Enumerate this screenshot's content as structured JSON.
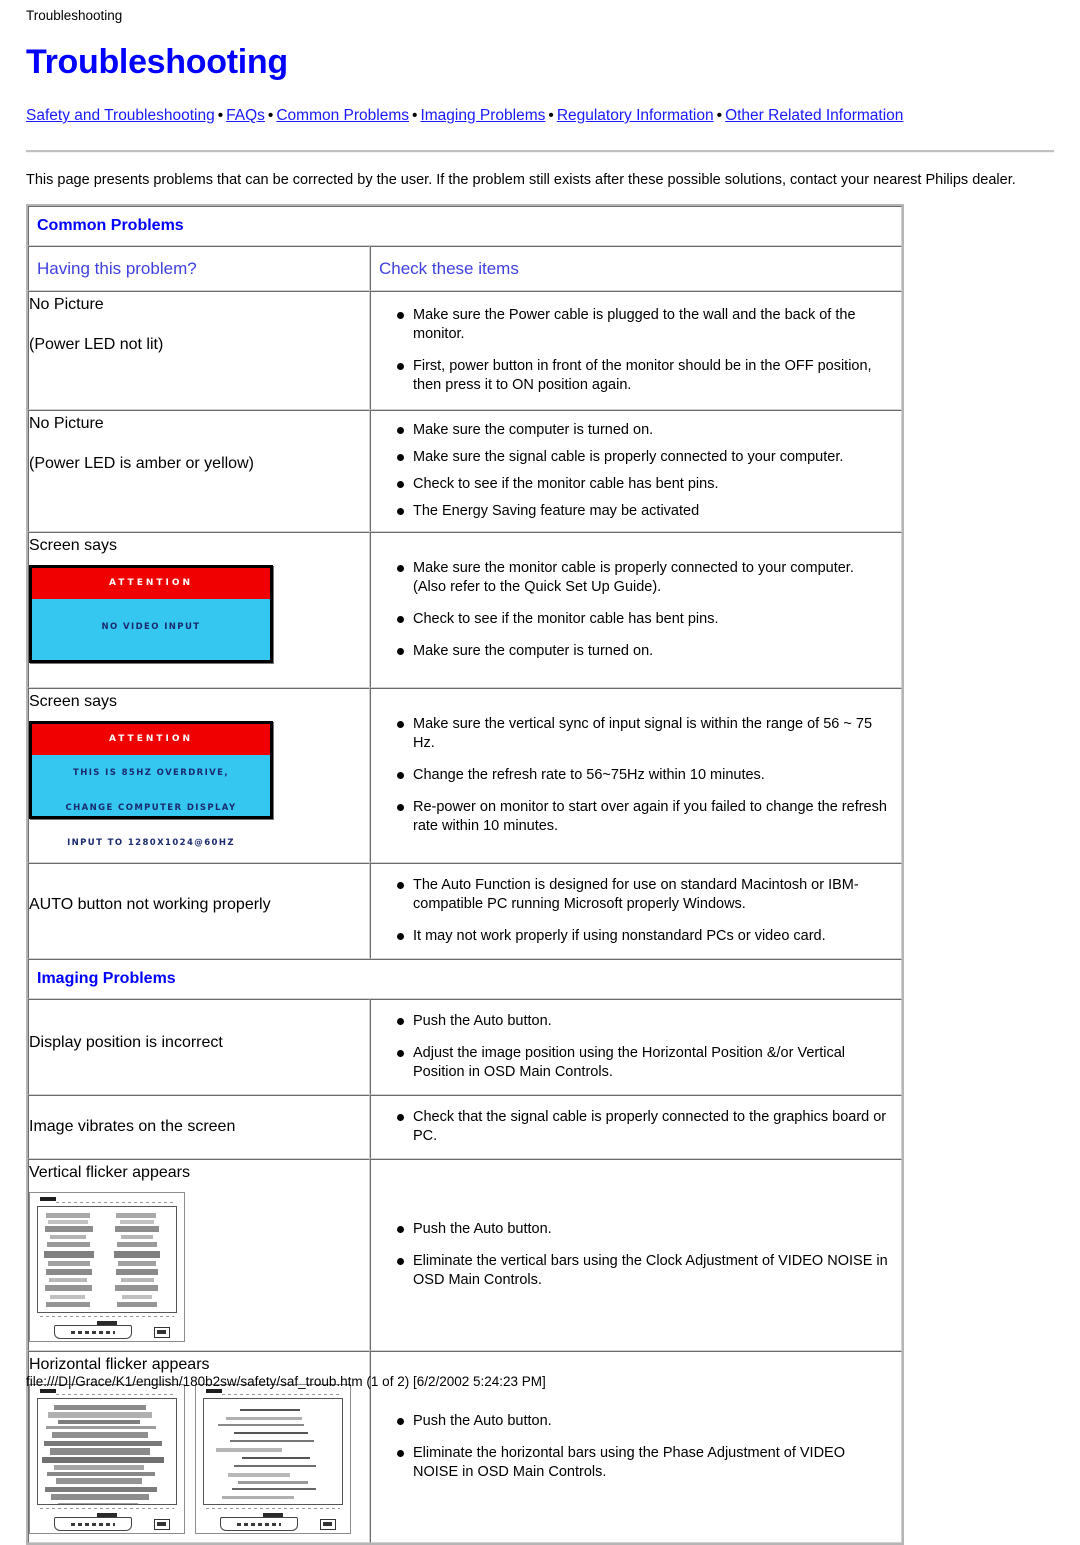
{
  "breadcrumb": "Troubleshooting",
  "title": "Troubleshooting",
  "nav": {
    "separator": "•",
    "links": [
      "Safety and Troubleshooting",
      "FAQs",
      "Common Problems",
      "Imaging Problems",
      "Regulatory Information",
      "Other Related Information"
    ]
  },
  "intro": "This page presents problems that can be corrected by the user. If the problem still exists after these possible solutions, contact your nearest Philips dealer.",
  "sections": {
    "common": {
      "heading": "Common Problems",
      "col1": "Having this problem?",
      "col2": "Check these items"
    },
    "imaging": {
      "heading": "Imaging Problems"
    }
  },
  "rows": {
    "no_picture_led_off": {
      "problem_line1": "No Picture",
      "problem_line2": "(Power LED not lit)",
      "checks": [
        "Make sure the Power cable is plugged to the wall and the back of the monitor.",
        "First, power button in front of the monitor should be in the OFF position, then press it to ON position again."
      ]
    },
    "no_picture_led_amber": {
      "problem_line1": "No Picture",
      "problem_line2": "(Power LED is amber or yellow)",
      "checks": [
        "Make sure the computer is turned on.",
        "Make sure the signal cable is properly connected to your computer.",
        "Check to see if the monitor cable has bent pins.",
        "The Energy Saving feature may be activated"
      ]
    },
    "screen_says_no_video": {
      "problem_line1": "Screen says",
      "osd": {
        "bar": "ATTENTION",
        "lines": [
          "NO VIDEO INPUT"
        ]
      },
      "checks": [
        "Make sure the monitor cable is properly connected to your computer. (Also refer to the Quick Set Up Guide).",
        "Check to see if the monitor cable has bent pins.",
        "Make sure the computer is turned on."
      ]
    },
    "screen_says_overdrive": {
      "problem_line1": "Screen says",
      "osd": {
        "bar": "ATTENTION",
        "lines": [
          "THIS IS 85HZ OVERDRIVE,",
          "CHANGE COMPUTER DISPLAY",
          "INPUT TO 1280X1024@60HZ"
        ]
      },
      "checks": [
        "Make sure the vertical sync of input signal is within the range of 56 ~ 75 Hz.",
        "Change the refresh rate to 56~75Hz within 10 minutes.",
        "Re-power on monitor to start over again if you failed to change the refresh rate within 10 minutes."
      ]
    },
    "auto_button": {
      "problem_line1": "AUTO button not working properly",
      "checks": [
        "The Auto Function is designed for use on standard Macintosh or IBM-compatible PC running Microsoft properly Windows.",
        "It may not work properly if using nonstandard PCs or video card."
      ]
    },
    "display_position": {
      "problem_line1": "Display position is incorrect",
      "checks": [
        "Push the Auto button.",
        "Adjust the image position using the Horizontal Position &/or Vertical Position in OSD Main Controls."
      ]
    },
    "image_vibrates": {
      "problem_line1": "Image vibrates on the screen",
      "checks": [
        "Check that the signal cable is properly connected to the graphics board or PC."
      ]
    },
    "vertical_flicker": {
      "problem_line1": "Vertical flicker appears",
      "checks": [
        "Push the Auto button.",
        "Eliminate the vertical bars using the Clock Adjustment of VIDEO NOISE in OSD Main Controls."
      ]
    },
    "horizontal_flicker": {
      "problem_line1": "Horizontal flicker appears",
      "checks": [
        "Push the Auto button.",
        "Eliminate the horizontal bars using the Phase Adjustment of VIDEO NOISE in OSD Main Controls."
      ]
    }
  },
  "footer": "file:///D|/Grace/K1/english/180b2sw/safety/saf_troub.htm (1 of 2) [6/2/2002 5:24:23 PM]",
  "colors": {
    "link": "#1a1aff",
    "title": "#0000ff",
    "section_heading": "#0000ff",
    "column_heading": "#4040e0",
    "osd_bar": "#f00000",
    "osd_screen": "#35c7f0",
    "osd_text": "#1a2a6e"
  }
}
